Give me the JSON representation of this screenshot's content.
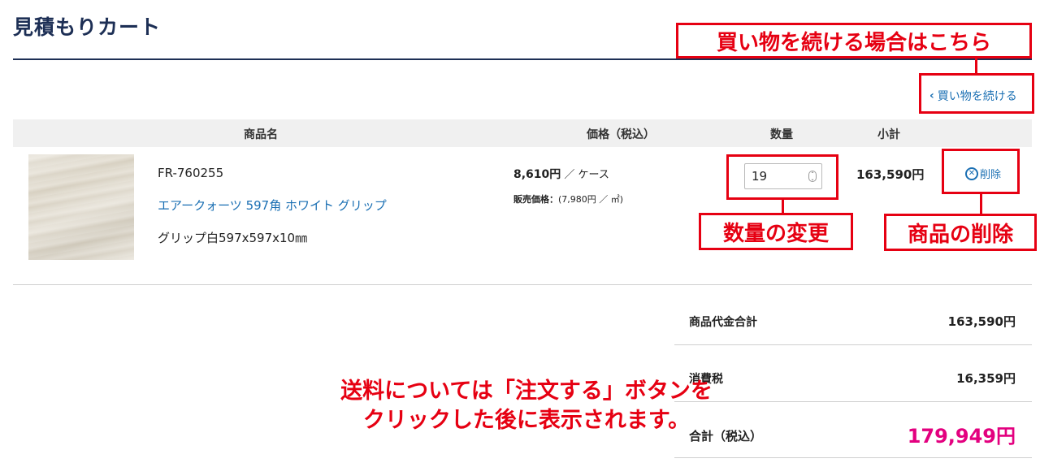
{
  "page": {
    "title": "見積もりカート"
  },
  "nav": {
    "continue_link": "買い物を続ける",
    "chevron": "‹"
  },
  "table": {
    "headers": {
      "product": "商品名",
      "price": "価格（税込）",
      "quantity": "数量",
      "subtotal": "小計"
    }
  },
  "item": {
    "sku": "FR-760255",
    "name": "エアークォーツ 597角 ホワイト グリップ",
    "description": "グリップ白597x597x10㎜",
    "price": "8,610円",
    "price_unit": " ／ ケース",
    "sale_label": "販売価格：",
    "sale_price": "(7,980円 ／ ㎡)",
    "quantity": "19",
    "subtotal": "163,590円",
    "delete_label": "削除",
    "delete_icon": "x-circle-icon"
  },
  "summary": {
    "goods_total_label": "商品代金合計",
    "goods_total_value": "163,590円",
    "tax_label": "消費税",
    "tax_value": "16,359円",
    "total_label": "合計（税込）",
    "total_value": "179,949円",
    "total_color": "#e3007f"
  },
  "annotations": {
    "continue_note": "買い物を続ける場合はこちら",
    "quantity_note": "数量の変更",
    "delete_note": "商品の削除",
    "shipping_note_line1": "送料については「注文する」ボタンを",
    "shipping_note_line2": "クリックした後に表示されます。",
    "color": "#e60012"
  }
}
